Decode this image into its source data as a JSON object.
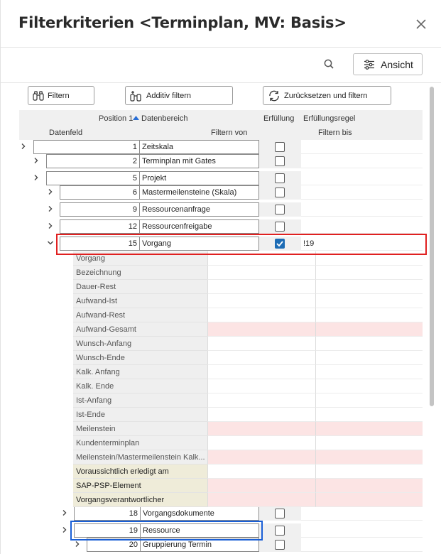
{
  "dialog": {
    "title": "Filterkriterien <Terminplan, MV: Basis>"
  },
  "toolbar": {
    "ansicht_label": "Ansicht"
  },
  "buttons": {
    "filtern": "Filtern",
    "additiv": "Additiv filtern",
    "reset": "Zurücksetzen und filtern"
  },
  "header": {
    "position": "Position 1",
    "datenbereich": "Datenbereich",
    "erfuellung": "Erfüllung",
    "erfuellungsregel": "Erfüllungsregel",
    "datenfeld": "Datenfeld",
    "filtern_von": "Filtern von",
    "filtern_bis": "Filtern bis"
  },
  "rows": [
    {
      "num": "1",
      "name": "Zeitskala",
      "checked": false,
      "filter": "",
      "chevron": "right"
    },
    {
      "num": "2",
      "name": "Terminplan mit Gates",
      "checked": false,
      "filter": "",
      "chevron": "right"
    },
    {
      "num": "5",
      "name": "Projekt",
      "checked": false,
      "filter": "",
      "chevron": "right"
    },
    {
      "num": "6",
      "name": "Mastermeilensteine (Skala)",
      "checked": false,
      "filter": "",
      "chevron": "right"
    },
    {
      "num": "9",
      "name": "Ressourcenanfrage",
      "checked": false,
      "filter": "",
      "chevron": "right"
    },
    {
      "num": "12",
      "name": "Ressourcenfreigabe",
      "checked": false,
      "filter": "",
      "chevron": "right"
    },
    {
      "num": "15",
      "name": "Vorgang",
      "checked": true,
      "filter": "!19",
      "chevron": "down"
    },
    {
      "num": "18",
      "name": "Vorgangsdokumente",
      "checked": false,
      "filter": "",
      "chevron": "right"
    },
    {
      "num": "19",
      "name": "Ressource",
      "checked": false,
      "filter": "",
      "chevron": "right"
    },
    {
      "num": "20",
      "name": "Gruppierung Termin",
      "checked": false,
      "filter": "",
      "chevron": "right"
    }
  ],
  "subfields": [
    {
      "label": "Vorgang",
      "style": "normal"
    },
    {
      "label": "Bezeichnung",
      "style": "normal"
    },
    {
      "label": "Dauer-Rest",
      "style": "normal"
    },
    {
      "label": "Aufwand-Ist",
      "style": "normal"
    },
    {
      "label": "Aufwand-Rest",
      "style": "normal"
    },
    {
      "label": "Aufwand-Gesamt",
      "style": "pink"
    },
    {
      "label": "Wunsch-Anfang",
      "style": "normal"
    },
    {
      "label": "Wunsch-Ende",
      "style": "normal"
    },
    {
      "label": "Kalk. Anfang",
      "style": "normal"
    },
    {
      "label": "Kalk. Ende",
      "style": "normal"
    },
    {
      "label": "Ist-Anfang",
      "style": "normal"
    },
    {
      "label": "Ist-Ende",
      "style": "normal"
    },
    {
      "label": "Meilenstein",
      "style": "pink"
    },
    {
      "label": "Kundenterminplan",
      "style": "normal"
    },
    {
      "label": "Meilenstein/Mastermeilenstein Kalk...",
      "style": "pink"
    },
    {
      "label": "Voraussichtlich erledigt am",
      "style": "beige"
    },
    {
      "label": "SAP-PSP-Element",
      "style": "beige-pink"
    },
    {
      "label": "Vorgangsverantwortlicher",
      "style": "beige-pink"
    }
  ],
  "colors": {
    "checkbox_checked": "#1d6cb5",
    "highlight_red": "#e02020",
    "highlight_blue": "#1a5fd6",
    "pink_cell": "#fce4e4",
    "beige_cell": "#efecd9"
  }
}
